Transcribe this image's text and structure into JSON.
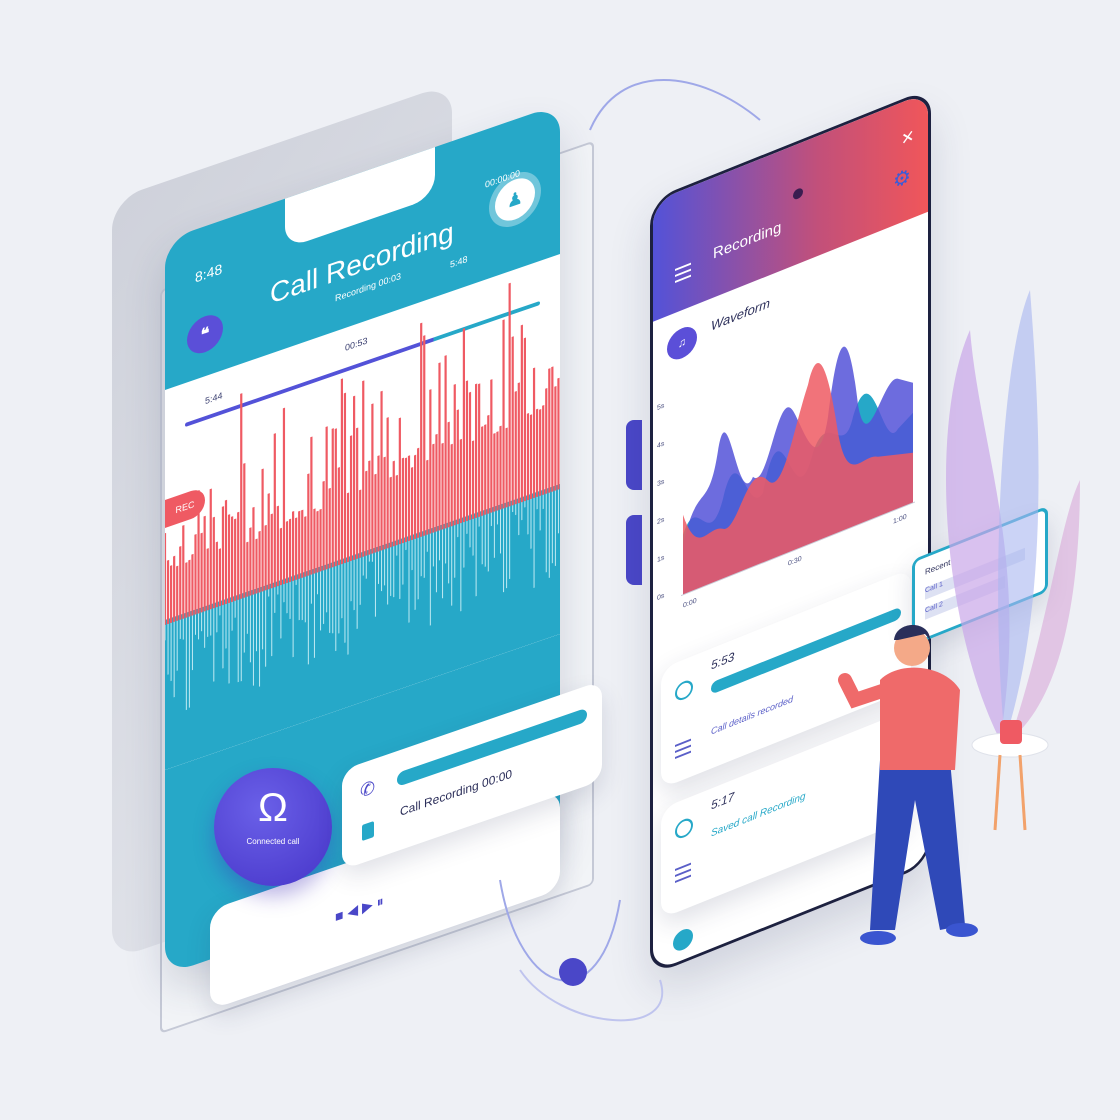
{
  "left_phone": {
    "status_time": "8:48",
    "title": "Call Recording",
    "subtitle": "Recording 00:03",
    "status_right": "00:00:00",
    "marker_1": "5:44",
    "marker_2": "00:53",
    "marker_3": "5:48",
    "side_tag": "REC",
    "record_button_label": "Connected call",
    "card_title": "Call Recording 00:00",
    "card_controls": "■ ◀ ▶ ⏸"
  },
  "right_phone": {
    "title": "Recording",
    "section_title": "Waveform",
    "y_ticks": [
      "0s",
      "1s",
      "2s",
      "3s",
      "4s",
      "5s"
    ],
    "x_ticks": [
      "0:00",
      "0:30",
      "1:00"
    ],
    "items": [
      {
        "time": "5:53",
        "text": "Call details recorded"
      },
      {
        "time": "5:17",
        "text": "Saved call Recording"
      }
    ]
  },
  "floating_panel": {
    "label": "Recent",
    "rows": [
      "Call 1",
      "Call 2"
    ]
  },
  "colors": {
    "teal": "#26a8c8",
    "red": "#ef5a63",
    "purple": "#5352d8",
    "navy": "#1d2140"
  }
}
